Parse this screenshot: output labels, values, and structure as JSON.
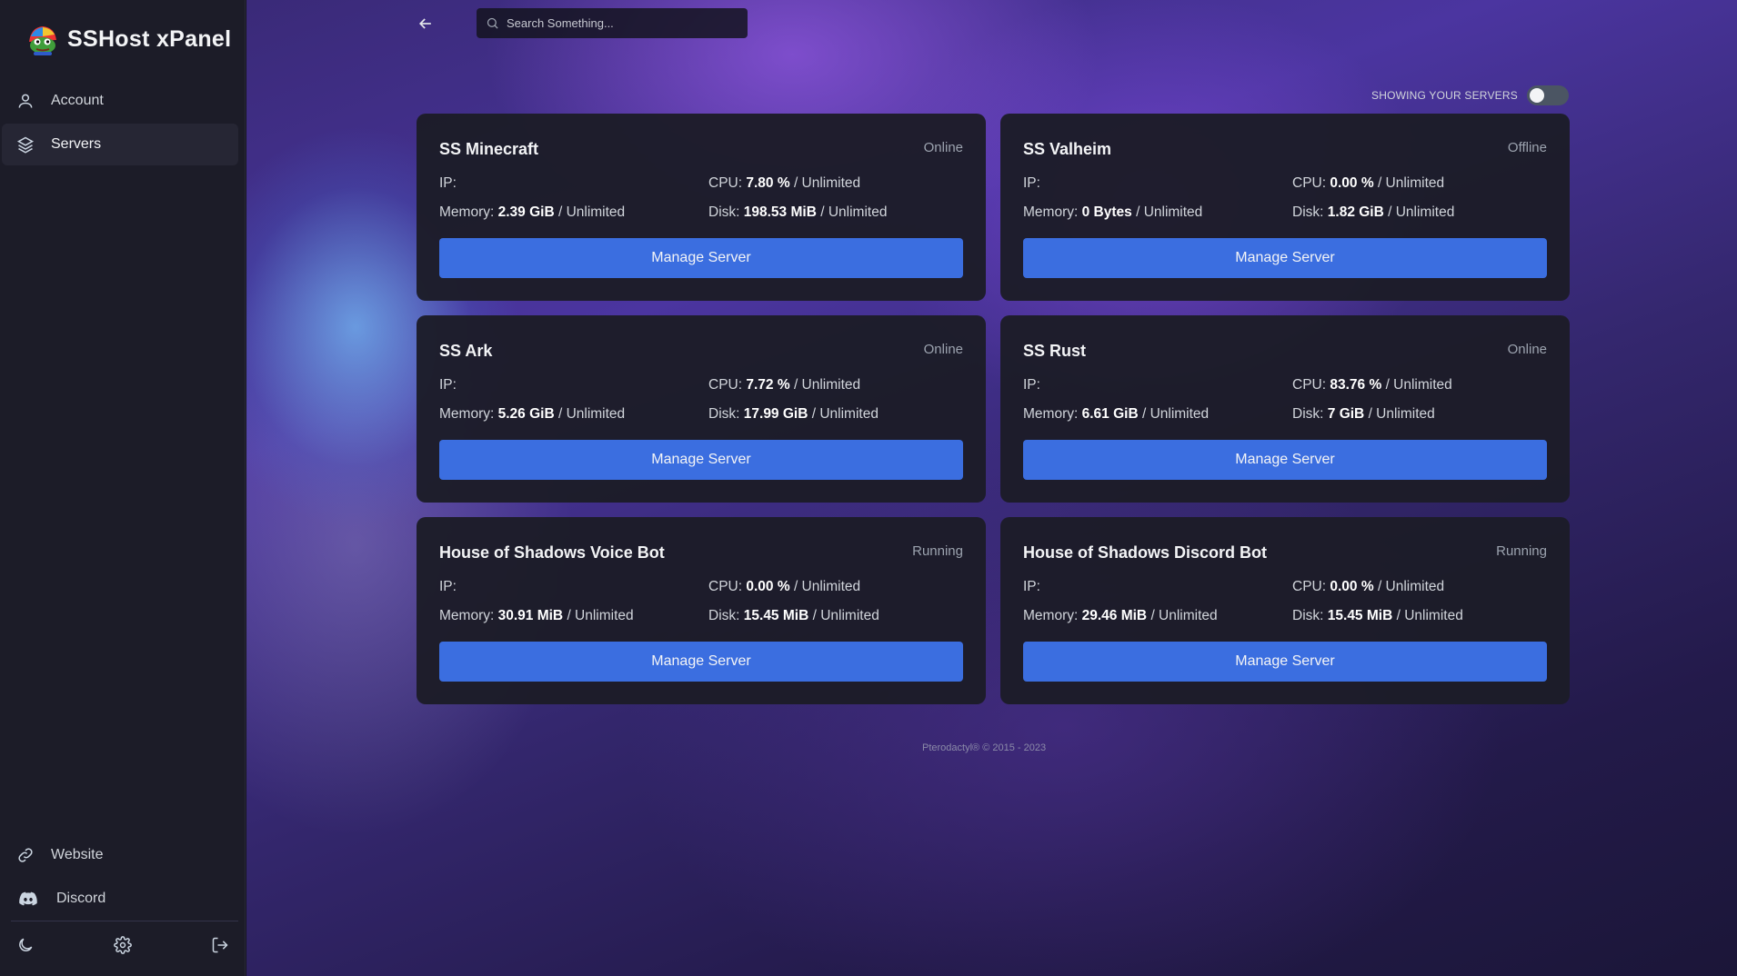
{
  "brand": {
    "title": "SSHost xPanel"
  },
  "sidebar": {
    "items": [
      {
        "label": "Account",
        "icon": "user-icon",
        "active": false
      },
      {
        "label": "Servers",
        "icon": "layers-icon",
        "active": true
      }
    ],
    "bottom_items": [
      {
        "label": "Website",
        "icon": "link-icon"
      },
      {
        "label": "Discord",
        "icon": "discord-icon"
      }
    ],
    "bottom_icons": [
      "moon-icon",
      "gear-icon",
      "logout-icon"
    ]
  },
  "header": {
    "search_placeholder": "Search Something...",
    "toggle_label": "SHOWING YOUR SERVERS",
    "toggle_on": false
  },
  "servers": [
    {
      "name": "SS Minecraft",
      "status": "Online",
      "ip_label": "IP:",
      "cpu_label": "CPU:",
      "cpu": "7.80 %",
      "cpu_limit": "/ Unlimited",
      "memory_label": "Memory:",
      "memory": "2.39 GiB",
      "memory_limit": "/ Unlimited",
      "disk_label": "Disk:",
      "disk": "198.53 MiB",
      "disk_limit": "/ Unlimited",
      "button": "Manage Server"
    },
    {
      "name": "SS Valheim",
      "status": "Offline",
      "ip_label": "IP:",
      "cpu_label": "CPU:",
      "cpu": "0.00 %",
      "cpu_limit": "/ Unlimited",
      "memory_label": "Memory:",
      "memory": "0 Bytes",
      "memory_limit": "/ Unlimited",
      "disk_label": "Disk:",
      "disk": "1.82 GiB",
      "disk_limit": "/ Unlimited",
      "button": "Manage Server"
    },
    {
      "name": "SS Ark",
      "status": "Online",
      "ip_label": "IP:",
      "cpu_label": "CPU:",
      "cpu": "7.72 %",
      "cpu_limit": "/ Unlimited",
      "memory_label": "Memory:",
      "memory": "5.26 GiB",
      "memory_limit": "/ Unlimited",
      "disk_label": "Disk:",
      "disk": "17.99 GiB",
      "disk_limit": "/ Unlimited",
      "button": "Manage Server"
    },
    {
      "name": "SS Rust",
      "status": "Online",
      "ip_label": "IP:",
      "cpu_label": "CPU:",
      "cpu": "83.76 %",
      "cpu_limit": "/ Unlimited",
      "memory_label": "Memory:",
      "memory": "6.61 GiB",
      "memory_limit": "/ Unlimited",
      "disk_label": "Disk:",
      "disk": "7 GiB",
      "disk_limit": "/ Unlimited",
      "button": "Manage Server"
    },
    {
      "name": "House of Shadows Voice Bot",
      "status": "Running",
      "ip_label": "IP:",
      "cpu_label": "CPU:",
      "cpu": "0.00 %",
      "cpu_limit": "/ Unlimited",
      "memory_label": "Memory:",
      "memory": "30.91 MiB",
      "memory_limit": "/ Unlimited",
      "disk_label": "Disk:",
      "disk": "15.45 MiB",
      "disk_limit": "/ Unlimited",
      "button": "Manage Server"
    },
    {
      "name": "House of Shadows Discord Bot",
      "status": "Running",
      "ip_label": "IP:",
      "cpu_label": "CPU:",
      "cpu": "0.00 %",
      "cpu_limit": "/ Unlimited",
      "memory_label": "Memory:",
      "memory": "29.46 MiB",
      "memory_limit": "/ Unlimited",
      "disk_label": "Disk:",
      "disk": "15.45 MiB",
      "disk_limit": "/ Unlimited",
      "button": "Manage Server"
    }
  ],
  "footer": {
    "text": "Pterodactyl® © 2015 - 2023"
  },
  "colors": {
    "accent": "#3b6ee0",
    "sidebar_bg": "#1c1c28",
    "card_bg": "#1c1c28"
  }
}
